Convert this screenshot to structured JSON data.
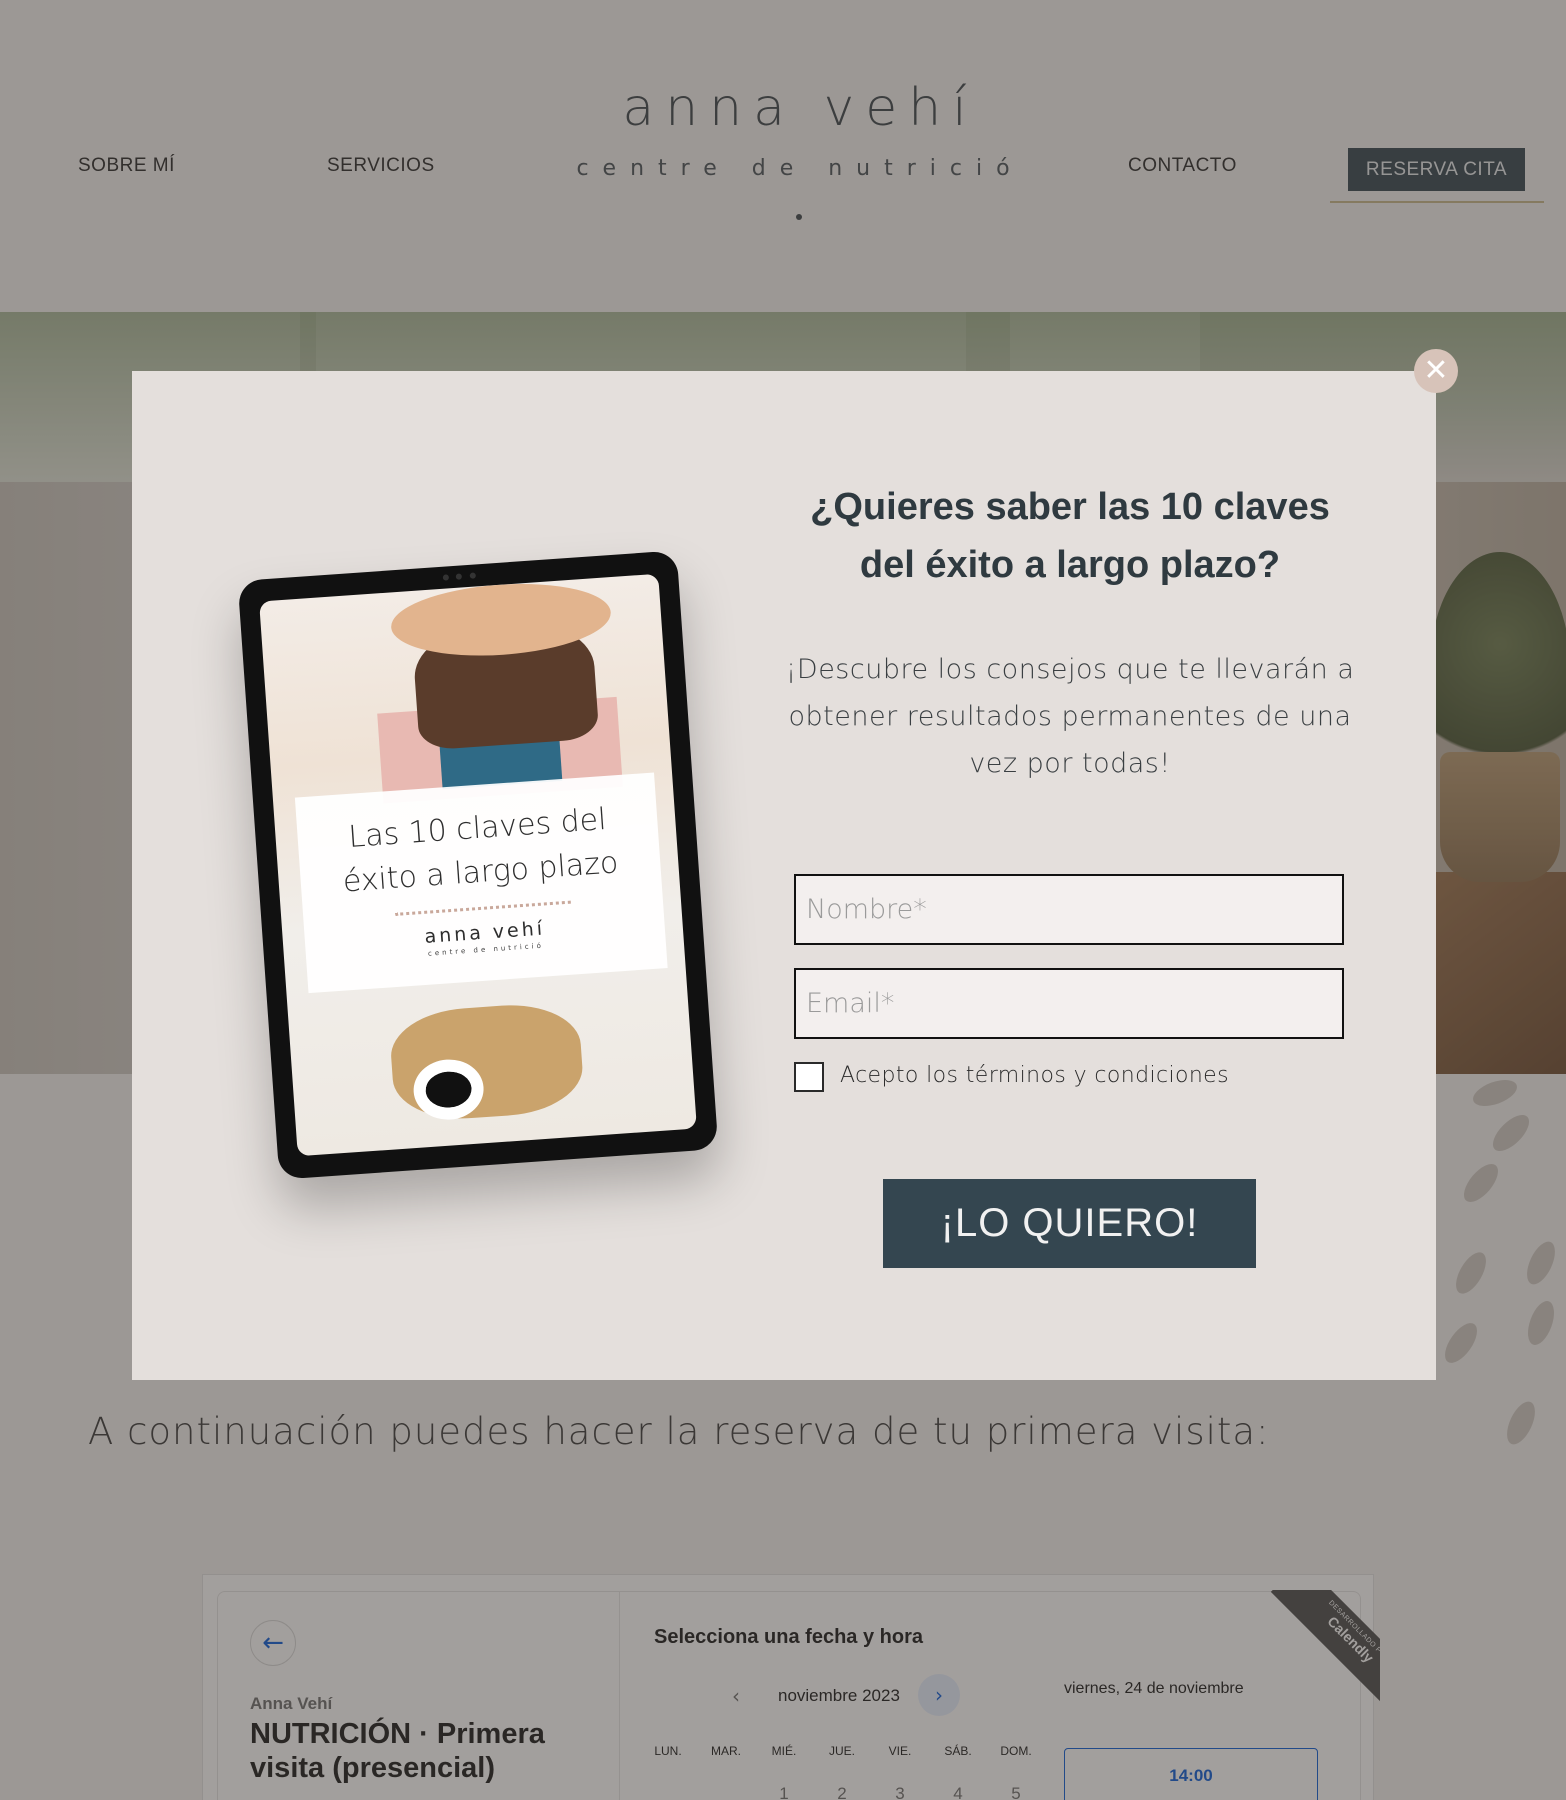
{
  "header": {
    "nav_left": [
      "SOBRE MÍ",
      "SERVICIOS"
    ],
    "nav_right": [
      "CONTACTO"
    ],
    "logo_name": "anna vehí",
    "logo_subtitle": "centre de nutrició",
    "cta_label": "RESERVA CITA"
  },
  "main": {
    "booking_intro": "A continuación puedes hacer la reserva de tu primera visita:"
  },
  "calendly": {
    "owner": "Anna Vehí",
    "event_title": "NUTRICIÓN · Primera visita (presencial)",
    "heading": "Selecciona una fecha y hora",
    "month": "noviembre 2023",
    "weekdays": [
      "LUN.",
      "MAR.",
      "MIÉ.",
      "JUE.",
      "VIE.",
      "SÁB.",
      "DOM."
    ],
    "first_row": [
      "",
      "",
      "1",
      "2",
      "3",
      "4",
      "5"
    ],
    "selected_date": "viernes, 24 de noviembre",
    "time_slot": "14:00",
    "ribbon_small": "DESARROLLADO POR",
    "ribbon_brand": "Calendly"
  },
  "popup": {
    "title": "¿Quieres saber las 10 claves del éxito a largo plazo?",
    "subtitle": "¡Descubre los consejos que te llevarán a obtener resultados permanentes de una vez por todas!",
    "name_placeholder": "Nombre*",
    "email_placeholder": "Email*",
    "terms_label": "Acepto los términos y condiciones",
    "submit_label": "¡LO QUIERO!",
    "close_icon": "close-icon",
    "ebook": {
      "title": "Las 10 claves del éxito a largo plazo",
      "brand": "anna vehí",
      "brand_sub": "centre de nutrició"
    }
  },
  "colors": {
    "accent_dark": "#344650",
    "popup_bg": "#e4dfdc",
    "calendly_blue": "#0b5cd8",
    "gold_line": "#c8b98a"
  }
}
